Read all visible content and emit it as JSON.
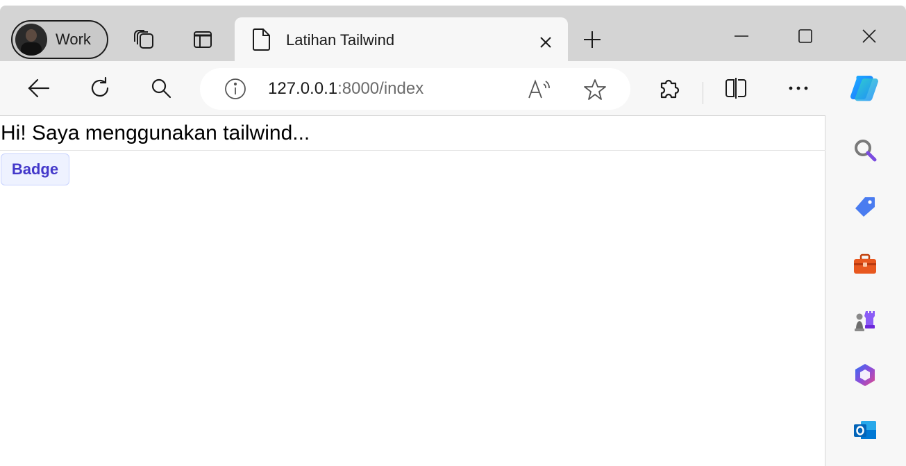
{
  "browser": {
    "profile": {
      "label": "Work"
    },
    "tab": {
      "title": "Latihan Tailwind"
    },
    "address": {
      "host": "127.0.0.1",
      "rest": ":8000/index"
    }
  },
  "page": {
    "heading": "Hi! Saya menggunakan tailwind...",
    "badge": "Badge"
  },
  "icons": {
    "workspaces": "workspaces-icon",
    "vertical_tabs": "vertical-tabs-icon",
    "page": "page-icon",
    "close": "close-icon",
    "new_tab": "plus-icon",
    "back": "back-arrow-icon",
    "refresh": "refresh-icon",
    "search": "search-icon",
    "info": "info-icon",
    "read_aloud": "read-aloud-icon",
    "favorite": "star-icon",
    "extensions": "extensions-icon",
    "split_screen": "split-screen-icon",
    "more": "more-icon",
    "copilot": "copilot-icon",
    "sidebar_search": "sidebar-search-icon",
    "shopping": "tag-icon",
    "tools": "toolbox-icon",
    "games": "chess-icon",
    "m365": "microsoft365-icon",
    "outlook": "outlook-icon"
  },
  "colors": {
    "badge_bg": "#eef2ff",
    "badge_text": "#4338ca",
    "badge_border": "#c7d2fe"
  }
}
